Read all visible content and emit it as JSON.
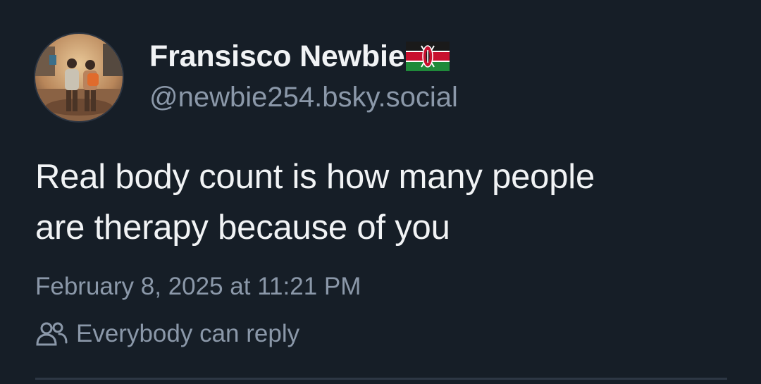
{
  "post": {
    "author": {
      "display_name": "Fransisco Newbie",
      "handle": "@newbie254.bsky.social",
      "flag_icon": "kenya-flag-icon"
    },
    "text_line1": "Real body count is how many people",
    "text_line2": "are therapy because of you",
    "timestamp": "February 8, 2025 at 11:21 PM",
    "reply_setting": {
      "icon": "people-icon",
      "label": "Everybody can reply"
    }
  },
  "colors": {
    "background": "#161e27",
    "primary_text": "#f1f3f5",
    "secondary_text": "#8b98a9"
  }
}
